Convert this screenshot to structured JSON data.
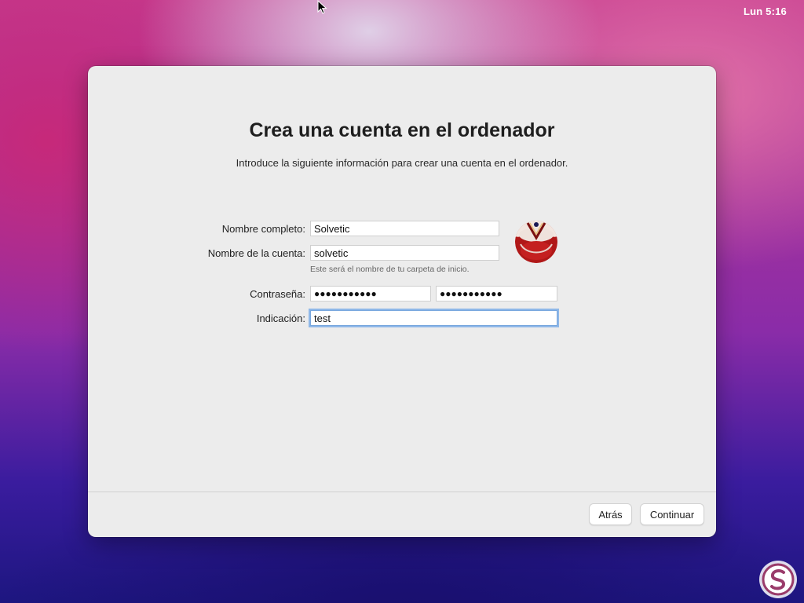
{
  "menubar": {
    "clock": "Lun 5:16"
  },
  "dialog": {
    "title": "Crea una cuenta en el ordenador",
    "subtitle": "Introduce la siguiente información para crear una cuenta en el ordenador.",
    "full_name": {
      "label": "Nombre completo:",
      "value": "Solvetic"
    },
    "account_name": {
      "label": "Nombre de la cuenta:",
      "value": "solvetic",
      "hint": "Este será el nombre de tu carpeta de inicio."
    },
    "password": {
      "label": "Contraseña:",
      "value": "●●●●●●●●●●●",
      "verify_value": "●●●●●●●●●●●"
    },
    "hint_field": {
      "label": "Indicación:",
      "value": "test"
    },
    "back_button": "Atrás",
    "continue_button": "Continuar"
  },
  "colors": {
    "window_bg": "#ececec",
    "focus_ring": "#8fb8e8"
  },
  "icons": {
    "avatar": "user-avatar-icon",
    "cursor": "mouse-pointer-icon",
    "watermark": "solvetic-logo-icon"
  }
}
